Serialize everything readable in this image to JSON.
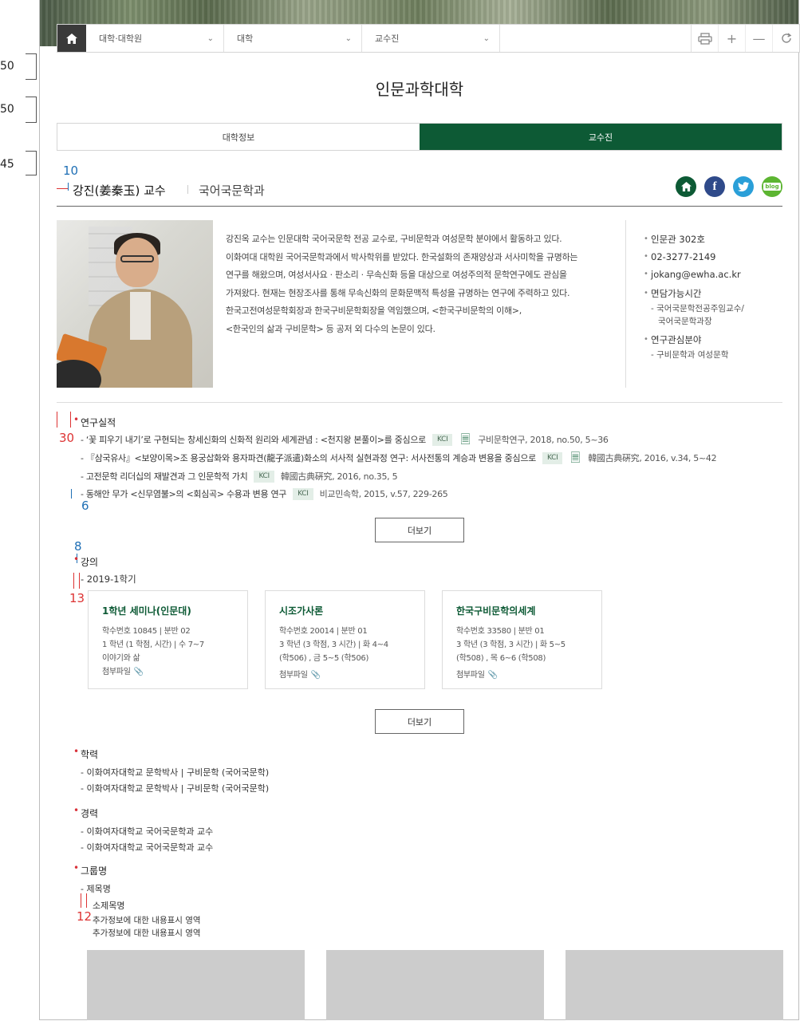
{
  "nav": {
    "home_icon": "home-icon",
    "select1": "대학·대학원",
    "select2": "대학",
    "select3": "교수진",
    "tools": [
      "print-icon",
      "zoom-in-icon",
      "zoom-out-icon",
      "refresh-icon"
    ]
  },
  "annotations": {
    "left": [
      "50",
      "50",
      "45"
    ],
    "blue": [
      "10",
      "6",
      "8"
    ],
    "red": [
      "30",
      "13",
      "12"
    ]
  },
  "page": {
    "title": "인문과학대학"
  },
  "tabs": [
    {
      "label": "대학정보",
      "active": false
    },
    {
      "label": "교수진",
      "active": true
    }
  ],
  "profile": {
    "name": "강진(姜秦玉) 교수",
    "department": "국어국문학과",
    "social": [
      {
        "icon": "home-icon",
        "color": "#0d5a35"
      },
      {
        "icon": "facebook-icon",
        "color": "#2f4a8a"
      },
      {
        "icon": "twitter-icon",
        "color": "#2a9fd8"
      },
      {
        "icon": "blog-icon",
        "color": "#5cb531"
      }
    ],
    "bio": [
      "강진옥 교수는 인문대학 국어국문학 전공 교수로, 구비문학과 여성문학 분야에서 활동하고 있다.",
      "이화여대 대학원 국어국문학과에서 박사학위를 받았다. 한국설화의 존재양상과 서사미학을 규명하는",
      "연구를 해왔으며, 여성서사요 · 판소리 · 무속신화 등을 대상으로 여성주의적 문학연구에도 관심을",
      "가져왔다. 현재는 현장조사를 통해 무속신화의 문화문맥적 특성을 규명하는 연구에 주력하고 있다.",
      "한국고전여성문학회장과 한국구비문학회장을 역임했으며, <한국구비문학의 이해>,",
      "<한국인의 삶과 구비문학> 등 공저 외 다수의 논문이 있다."
    ],
    "contact": {
      "office": "인문관 302호",
      "phone": "02-3277-2149",
      "email": "jokang@ewha.ac.kr",
      "office_hours_label": "면담가능시간",
      "office_hours": [
        "- 국어국문학전공주임교수/",
        "국어국문학과장"
      ],
      "research_label": "연구관심분야",
      "research": "- 구비문학과 여성문학"
    }
  },
  "research": {
    "title": "연구실적",
    "items": [
      {
        "text": "- ‘꽃 피우기 내기’로 구현되는 창세신화의 신화적 원리와 세계관념 : <천지왕 본풀이>를 중심으로",
        "badge": "KCI",
        "icon": true,
        "journal": "구비문학연구, 2018, no.50, 5~36"
      },
      {
        "text": "- 『삼국유사』<보양이목>조 용궁삽화와 용자파견(龍子派遣)화소의 서사적 실현과정 연구: 서사전통의 계승과 변용을 중심으로",
        "badge": "KCI",
        "icon": true,
        "journal": "韓國古典硏究, 2016, v.34, 5~42"
      },
      {
        "text": "- 고전문학 리더십의 재발견과 그 인문학적 가치",
        "badge": "KCI",
        "icon": false,
        "journal": "韓國古典硏究, 2016, no.35, 5"
      },
      {
        "text": "- 동해안 무가 <신무염불>의 <회심곡> 수용과 변용 연구",
        "badge": "KCI",
        "icon": false,
        "journal": "비교민속학, 2015, v.57, 229-265"
      }
    ],
    "more": "더보기"
  },
  "lecture": {
    "title": "강의",
    "semester": "- 2019-1학기",
    "cards": [
      {
        "title": "1학년 세미나(인문대)",
        "lines": [
          "학수번호 10845 |  분반 02",
          "1 학년 (1 학점, 시간) | 수 7~7",
          "이야기와 삶"
        ],
        "attach": "첨부파일"
      },
      {
        "title": "시조가사론",
        "lines": [
          "학수번호 20014 |  분반 01",
          "3 학년 (3 학점, 3 시간) | 화 4~4",
          "(학506) , 금 5~5 (학506)"
        ],
        "attach": "첨부파일"
      },
      {
        "title": "한국구비문학의세계",
        "lines": [
          "학수번호 33580 |  분반 01",
          "3 학년 (3 학점, 3 시간) | 화 5~5",
          "(학508) , 목 6~6 (학508)"
        ],
        "attach": "첨부파일"
      }
    ],
    "more": "더보기"
  },
  "education": {
    "title": "학력",
    "items": [
      "- 이화여자대학교 문학박사  |  구비문학 (국어국문학)",
      "- 이화여자대학교 문학박사  |  구비문학 (국어국문학)"
    ]
  },
  "career": {
    "title": "경력",
    "items": [
      "- 이화여자대학교 국어국문학과 교수",
      "- 이화여자대학교 국어국문학과 교수"
    ]
  },
  "group": {
    "title": "그룹명",
    "heading": "- 제목명",
    "subheading": "소제목명",
    "extra": [
      "추가정보에 대한 내용표시 영역",
      "추가정보에 대한 내용표시 영역"
    ]
  }
}
